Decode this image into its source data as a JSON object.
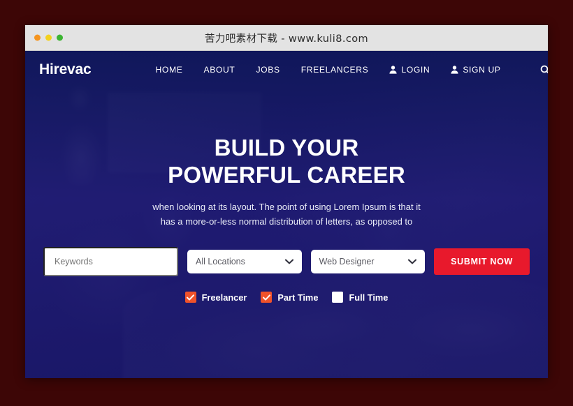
{
  "window": {
    "title": "苦力吧素材下载 - www.kuli8.com",
    "controls": [
      {
        "name": "close",
        "color": "#f5941f"
      },
      {
        "name": "minimize",
        "color": "#f3d11e"
      },
      {
        "name": "maximize",
        "color": "#3cb432"
      }
    ]
  },
  "site": {
    "logo": "Hirevac",
    "nav": [
      {
        "label": "HOME",
        "icon": ""
      },
      {
        "label": "ABOUT",
        "icon": ""
      },
      {
        "label": "JOBS",
        "icon": ""
      },
      {
        "label": "FREELANCERS",
        "icon": ""
      },
      {
        "label": "LOGIN",
        "icon": "user-icon"
      },
      {
        "label": "SIGN UP",
        "icon": "user-icon"
      }
    ],
    "search_icon": "search-icon"
  },
  "hero": {
    "headline_line1": "BUILD YOUR",
    "headline_line2": "POWERFUL CAREER",
    "subtitle_line1": "when looking at its layout. The point of using Lorem Ipsum is that it",
    "subtitle_line2": "has a more-or-less normal distribution of letters, as opposed to",
    "form": {
      "keywords_placeholder": "Keywords",
      "keywords_value": "",
      "location_value": "All Locations",
      "category_value": "Web Designer",
      "submit_label": "SUBMIT NOW"
    },
    "filters": [
      {
        "label": "Freelancer",
        "checked": true
      },
      {
        "label": "Part Time",
        "checked": true
      },
      {
        "label": "Full Time",
        "checked": false
      }
    ]
  },
  "colors": {
    "page_background": "#3d0606",
    "hero_overlay": "#1b1560",
    "nav_background": "#111a5c",
    "accent_red": "#e8192c",
    "accent_orange": "#f0522a",
    "titlebar": "#e3e3e3"
  }
}
